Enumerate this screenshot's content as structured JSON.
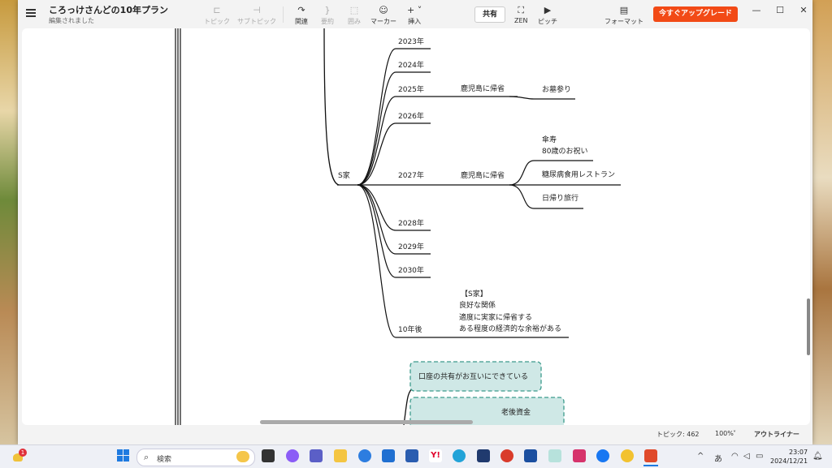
{
  "app": {
    "title": "ころっけさんどの10年プラン",
    "status": "編集されました"
  },
  "toolbar": {
    "topic": "トピック",
    "subtopic": "サブトピック",
    "relation": "関連",
    "summary": "要約",
    "boundary": "囲み",
    "marker": "マーカー",
    "insert": "挿入",
    "share": "共有",
    "zen": "ZEN",
    "pitch": "ピッチ",
    "format": "フォーマット",
    "upgrade": "今すぐアップグレード"
  },
  "mindmap": {
    "root": "S家",
    "years": [
      {
        "label": "2023年"
      },
      {
        "label": "2024年"
      },
      {
        "label": "2025年",
        "child": "鹿児島に帰省",
        "grandchildren": [
          "お墓参り"
        ]
      },
      {
        "label": "2026年"
      },
      {
        "label": "2027年",
        "child": "鹿児島に帰省",
        "grandchildren": [
          "傘寿",
          "80歳のお祝い",
          "糖尿病食用レストラン",
          "日帰り旅行"
        ]
      },
      {
        "label": "2028年"
      },
      {
        "label": "2029年"
      },
      {
        "label": "2030年"
      },
      {
        "label": "10年後",
        "note": [
          "【S家】",
          "良好な関係",
          "適度に実家に帰省する",
          "ある程度の経済的な余裕がある"
        ]
      }
    ],
    "boxes": [
      "口座の共有がお互いにできている",
      "老後資金"
    ]
  },
  "statusbar": {
    "topics": "トピック: 462",
    "zoom": "100%",
    "outliner": "アウトライナー"
  },
  "taskbar": {
    "search_placeholder": "検索",
    "notification_count": "1",
    "ime": "あ",
    "time": "23:07",
    "date": "2024/12/21"
  },
  "colors": {
    "upgrade": "#f24a16",
    "box_fill": "#cfe8e6",
    "box_border": "#3c9b8c"
  }
}
